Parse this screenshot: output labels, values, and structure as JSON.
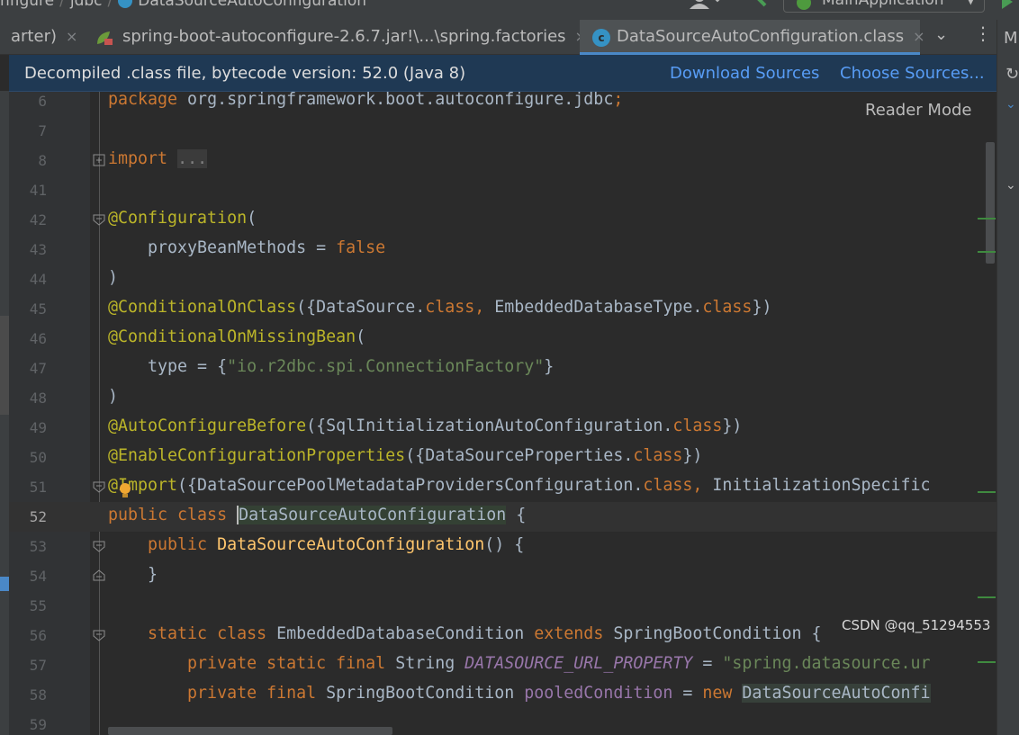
{
  "breadcrumb": {
    "segments": [
      "nfigure",
      "jdbc",
      "DataSourceAutoConfiguration"
    ]
  },
  "toolbar": {
    "run_config_label": "MainApplication"
  },
  "tabs": [
    {
      "label": "arter)",
      "active": false
    },
    {
      "label": "spring-boot-autoconfigure-2.6.7.jar!\\...\\spring.factories",
      "active": false
    },
    {
      "label": "DataSourceAutoConfiguration.class",
      "active": true
    }
  ],
  "tab_close_glyph": "×",
  "right_strip": {
    "first_letter": "M"
  },
  "banner": {
    "message": "Decompiled .class file, bytecode version: 52.0 (Java 8)",
    "download_sources": "Download Sources",
    "choose_sources": "Choose Sources..."
  },
  "editor": {
    "reader_mode": "Reader Mode",
    "current_line": "52",
    "lines": [
      {
        "no": "6"
      },
      {
        "no": "7"
      },
      {
        "no": "8"
      },
      {
        "no": "41"
      },
      {
        "no": "42"
      },
      {
        "no": "43"
      },
      {
        "no": "44"
      },
      {
        "no": "45"
      },
      {
        "no": "46"
      },
      {
        "no": "47"
      },
      {
        "no": "48"
      },
      {
        "no": "49"
      },
      {
        "no": "50"
      },
      {
        "no": "51"
      },
      {
        "no": "52"
      },
      {
        "no": "53"
      },
      {
        "no": "54"
      },
      {
        "no": "55"
      },
      {
        "no": "56"
      },
      {
        "no": "57"
      },
      {
        "no": "58"
      },
      {
        "no": "59"
      }
    ],
    "tokens": {
      "l6": [
        "package",
        " org.springframework.boot.autoconfigure.jdbc",
        ";"
      ],
      "l8": [
        "import",
        " ",
        "..."
      ],
      "l42": [
        "@Configuration",
        "("
      ],
      "l43": [
        "    proxyBeanMethods = ",
        "false"
      ],
      "l44": [
        ")"
      ],
      "l45": [
        "@ConditionalOnClass",
        "({DataSource.",
        "class",
        ", ",
        "EmbeddedDatabaseType.",
        "class",
        "})"
      ],
      "l46": [
        "@ConditionalOnMissingBean",
        "("
      ],
      "l47": [
        "    type = {",
        "\"io.r2dbc.spi.ConnectionFactory\"",
        "}"
      ],
      "l48": [
        ")"
      ],
      "l49": [
        "@AutoConfigureBefore",
        "({SqlInitializationAutoConfiguration.",
        "class",
        "})"
      ],
      "l50": [
        "@EnableConfigurationProperties",
        "({DataSourceProperties.",
        "class",
        "})"
      ],
      "l51": [
        "@Import",
        "({DataSourcePoolMetadataProvidersConfiguration.",
        "class",
        ", ",
        "InitializationSpecific"
      ],
      "l52": [
        "public class ",
        "DataSourceAutoConfiguration",
        " {"
      ],
      "l53": [
        "    public ",
        "DataSourceAutoConfiguration",
        "() {"
      ],
      "l54": [
        "    }"
      ],
      "l56": [
        "    static class ",
        "EmbeddedDatabaseCondition ",
        "extends ",
        "SpringBootCondition {"
      ],
      "l57": [
        "        private static final ",
        "String ",
        "DATASOURCE_URL_PROPERTY",
        " = ",
        "\"spring.datasource.ur"
      ],
      "l58": [
        "        private final ",
        "SpringBootCondition ",
        "pooledCondition",
        " = ",
        "new ",
        "DataSourceAutoConfi"
      ]
    }
  },
  "watermark": "CSDN @qq_51294553",
  "colors": {
    "background": "#2b2b2b",
    "keyword": "#cc7832",
    "annotation": "#bbb529",
    "string": "#6a8759",
    "function": "#ffc66d",
    "constant": "#9876aa",
    "banner_bg": "#1f3954",
    "link": "#589df6"
  }
}
